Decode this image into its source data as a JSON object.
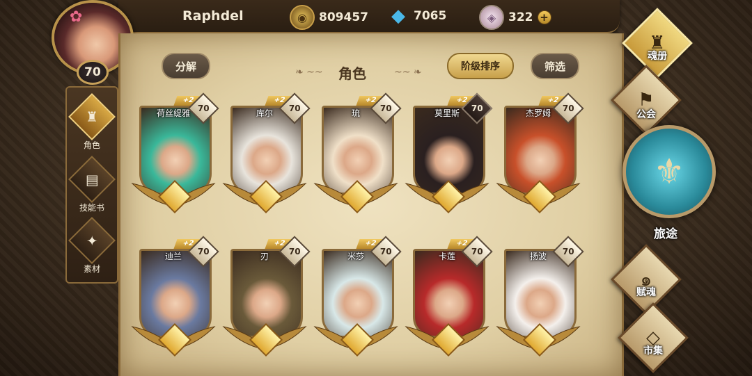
{
  "player": {
    "name": "Raphdel",
    "level": "70"
  },
  "currencies": [
    {
      "icon": "gold-coin-icon",
      "value": "809457"
    },
    {
      "icon": "blue-gem-icon",
      "value": "7065"
    },
    {
      "icon": "crystal-icon",
      "value": "322"
    }
  ],
  "left_menu": [
    {
      "label": "角色",
      "icon": "character-icon"
    },
    {
      "label": "技能书",
      "icon": "skill-book-icon"
    },
    {
      "label": "素材",
      "icon": "material-icon"
    }
  ],
  "toolbar": {
    "decompose": "分解",
    "title": "角色",
    "sort": "阶级排序",
    "filter": "筛选"
  },
  "characters": [
    {
      "name": "荷丝缇雅",
      "plus": "+2",
      "level": "70",
      "hair": "#3ab89a"
    },
    {
      "name": "库尔",
      "plus": "+2",
      "level": "70",
      "hair": "#e8e4dc"
    },
    {
      "name": "琉",
      "plus": "+2",
      "level": "70",
      "hair": "#f0e0c8"
    },
    {
      "name": "莫里斯",
      "plus": "+2",
      "level": "70",
      "hair": "#2a2020"
    },
    {
      "name": "杰罗姆",
      "plus": "+2",
      "level": "70",
      "hair": "#c8502a"
    },
    {
      "name": "迪兰",
      "plus": "+2",
      "level": "70",
      "hair": "#6a7aa0"
    },
    {
      "name": "刃",
      "plus": "+2",
      "level": "70",
      "hair": "#6a5a3a"
    },
    {
      "name": "米莎",
      "plus": "+2",
      "level": "70",
      "hair": "#d8e8e8"
    },
    {
      "name": "卡莲",
      "plus": "+2",
      "level": "70",
      "hair": "#b82a2a"
    },
    {
      "name": "扬波",
      "plus": "",
      "level": "70",
      "hair": "#f4f0ec"
    }
  ],
  "right_menu": {
    "soul_book": "魂册",
    "guild": "公会",
    "journey": "旅途",
    "endow_soul": "赋魂",
    "market": "市集"
  }
}
